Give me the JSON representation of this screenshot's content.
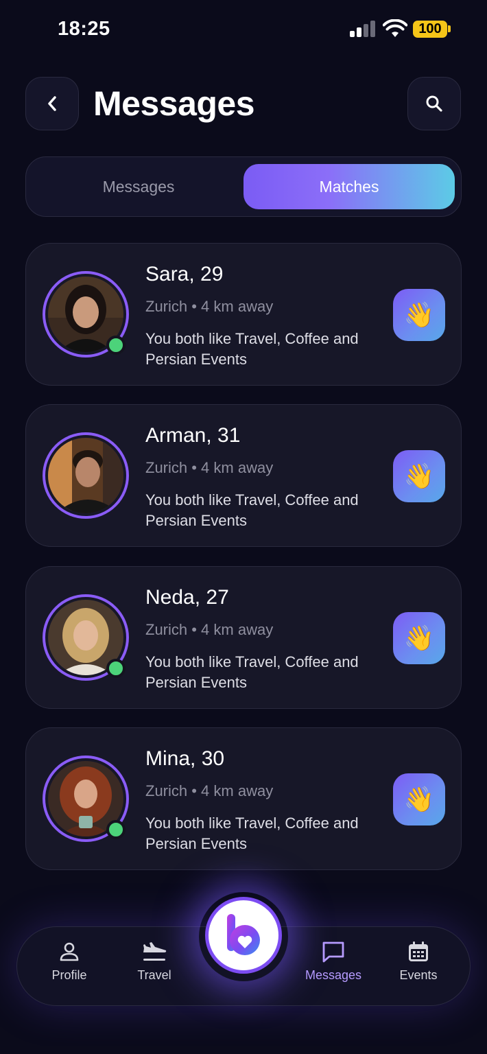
{
  "status_bar": {
    "time": "18:25",
    "battery": "100"
  },
  "header": {
    "title": "Messages"
  },
  "segments": {
    "left": "Messages",
    "right": "Matches",
    "active": "Matches"
  },
  "matches": [
    {
      "name": "Sara, 29",
      "location": "Zurich • 4 km away",
      "interests": "You both like Travel, Coffee and Persian Events",
      "online": true,
      "action": "👋"
    },
    {
      "name": "Arman, 31",
      "location": "Zurich • 4 km away",
      "interests": "You both like Travel, Coffee and Persian Events",
      "online": false,
      "action": "👋"
    },
    {
      "name": "Neda, 27",
      "location": "Zurich • 4 km away",
      "interests": "You both like Travel, Coffee and Persian Events",
      "online": true,
      "action": "👋"
    },
    {
      "name": "Mina, 30",
      "location": "Zurich • 4 km away",
      "interests": "You both like Travel, Coffee and Persian Events",
      "online": true,
      "action": "👋"
    }
  ],
  "nav": {
    "profile": "Profile",
    "travel": "Travel",
    "messages": "Messages",
    "events": "Events",
    "active": "Messages"
  },
  "colors": {
    "background": "#0b0b1b",
    "accent": "#8a5cf6",
    "online": "#4cd37a",
    "gradient_start": "#7b5cf4",
    "gradient_end": "#5ccbe6"
  },
  "icons": {
    "back": "chevron-left-icon",
    "search": "search-icon",
    "wave": "waving-hand-icon",
    "profile": "person-icon",
    "travel": "airplane-icon",
    "messages": "chat-bubble-icon",
    "events": "calendar-icon",
    "center": "app-logo-heart-icon"
  }
}
